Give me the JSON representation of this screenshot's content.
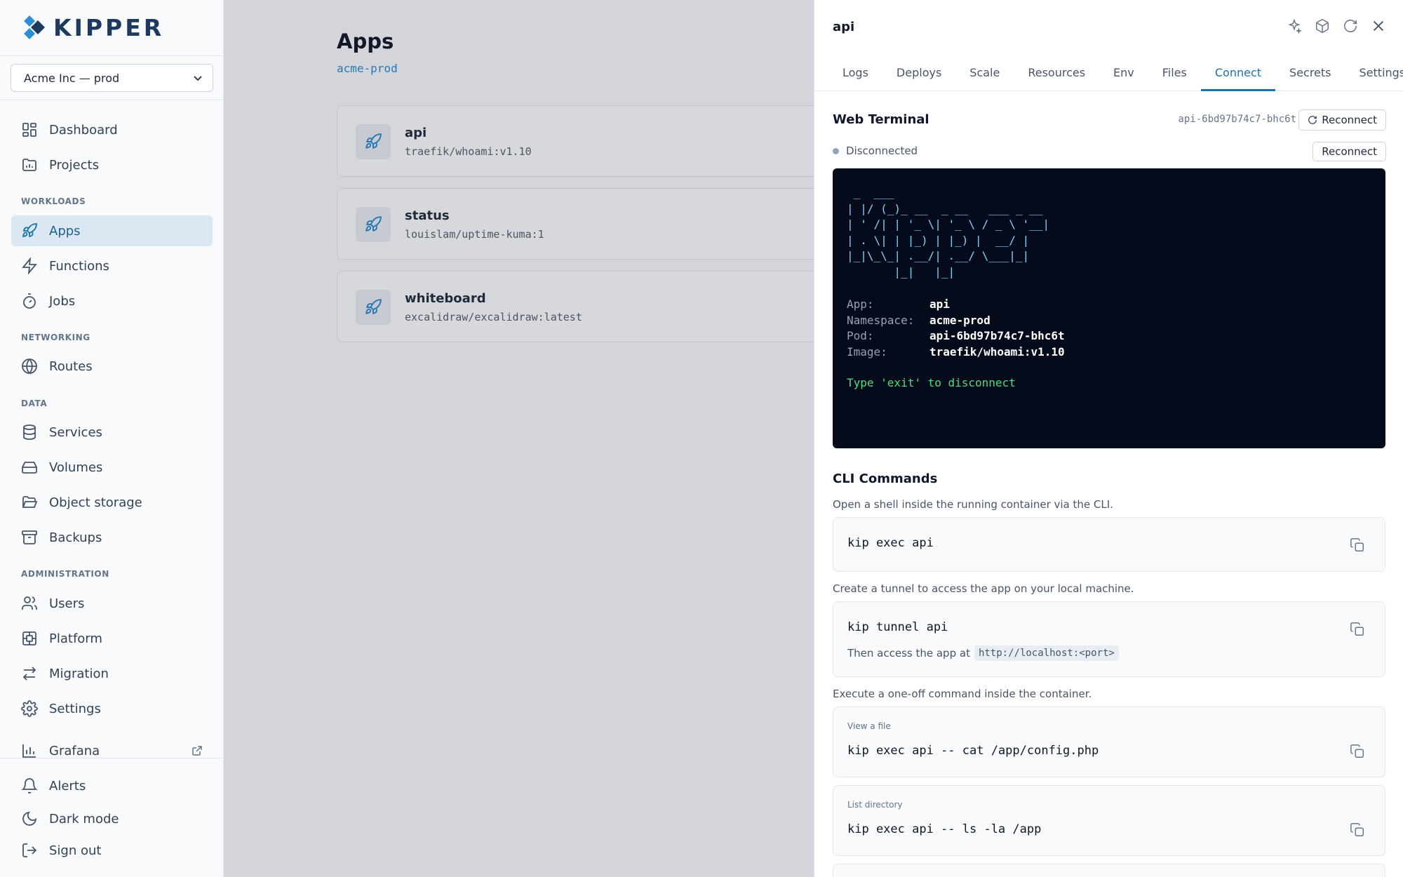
{
  "brand": {
    "name": "KIPPER",
    "accent": "#1d72aa"
  },
  "org_select": {
    "value": "Acme Inc — prod"
  },
  "nav": {
    "top": [
      {
        "label": "Dashboard",
        "icon": "grid-icon"
      },
      {
        "label": "Projects",
        "icon": "folder-chart-icon"
      }
    ],
    "workloads": {
      "title": "WORKLOADS",
      "items": [
        {
          "label": "Apps",
          "icon": "rocket-icon",
          "active": true
        },
        {
          "label": "Functions",
          "icon": "bolt-icon"
        },
        {
          "label": "Jobs",
          "icon": "timer-icon"
        }
      ]
    },
    "networking": {
      "title": "NETWORKING",
      "items": [
        {
          "label": "Routes",
          "icon": "globe-icon"
        }
      ]
    },
    "data": {
      "title": "DATA",
      "items": [
        {
          "label": "Services",
          "icon": "database-icon"
        },
        {
          "label": "Volumes",
          "icon": "hard-drive-icon"
        },
        {
          "label": "Object storage",
          "icon": "folder-open-icon"
        },
        {
          "label": "Backups",
          "icon": "archive-icon"
        }
      ]
    },
    "administration": {
      "title": "ADMINISTRATION",
      "items": [
        {
          "label": "Users",
          "icon": "users-icon"
        },
        {
          "label": "Platform",
          "icon": "platform-icon"
        },
        {
          "label": "Migration",
          "icon": "arrows-icon"
        },
        {
          "label": "Settings",
          "icon": "gear-icon"
        }
      ]
    },
    "grafana": {
      "label": "Grafana",
      "icon": "chart-icon"
    },
    "bottom": [
      {
        "label": "Alerts",
        "icon": "bell-icon"
      },
      {
        "label": "Dark mode",
        "icon": "moon-icon"
      },
      {
        "label": "Sign out",
        "icon": "logout-icon"
      }
    ]
  },
  "main": {
    "title": "Apps",
    "namespace": "acme-prod",
    "apps": [
      {
        "name": "api",
        "image": "traefik/whoami:v1.10"
      },
      {
        "name": "status",
        "image": "louislam/uptime-kuma:1"
      },
      {
        "name": "whiteboard",
        "image": "excalidraw/excalidraw:latest"
      }
    ]
  },
  "panel": {
    "title": "api",
    "tabs": [
      "Logs",
      "Deploys",
      "Scale",
      "Resources",
      "Env",
      "Files",
      "Connect",
      "Secrets",
      "Settings"
    ],
    "active_tab": "Connect",
    "web_terminal": {
      "title": "Web Terminal",
      "pod": "api-6bd97b74c7-bhc6t",
      "reconnect_label": "Reconnect",
      "status": "Disconnected",
      "ascii_art": " _  ___                       \n| |/ (_)_ __  _ __   ___ _ __ \n| ' /| | '_ \\| '_ \\ / _ \\ '__|\n| . \\| | |_) | |_) |  __/ |   \n|_|\\_\\_| .__/| .__/ \\___|_|   \n       |_|   |_|              ",
      "info": [
        {
          "key": "App:",
          "value": "api"
        },
        {
          "key": "Namespace:",
          "value": "acme-prod"
        },
        {
          "key": "Pod:",
          "value": "api-6bd97b74c7-bhc6t"
        },
        {
          "key": "Image:",
          "value": "traefik/whoami:v1.10"
        }
      ],
      "hint": "Type 'exit' to disconnect"
    },
    "cli": {
      "title": "CLI Commands",
      "shell_desc": "Open a shell inside the running container via the CLI.",
      "shell_cmd": "kip exec api",
      "tunnel_desc": "Create a tunnel to access the app on your local machine.",
      "tunnel_cmd": "kip tunnel api",
      "tunnel_note": "Then access the app at",
      "tunnel_url": "http://localhost:<port>",
      "oneoff_desc": "Execute a one-off command inside the container.",
      "view_label": "View a file",
      "view_cmd": "kip exec api -- cat /app/config.php",
      "list_label": "List directory",
      "list_cmd": "kip exec api -- ls -la /app"
    }
  }
}
